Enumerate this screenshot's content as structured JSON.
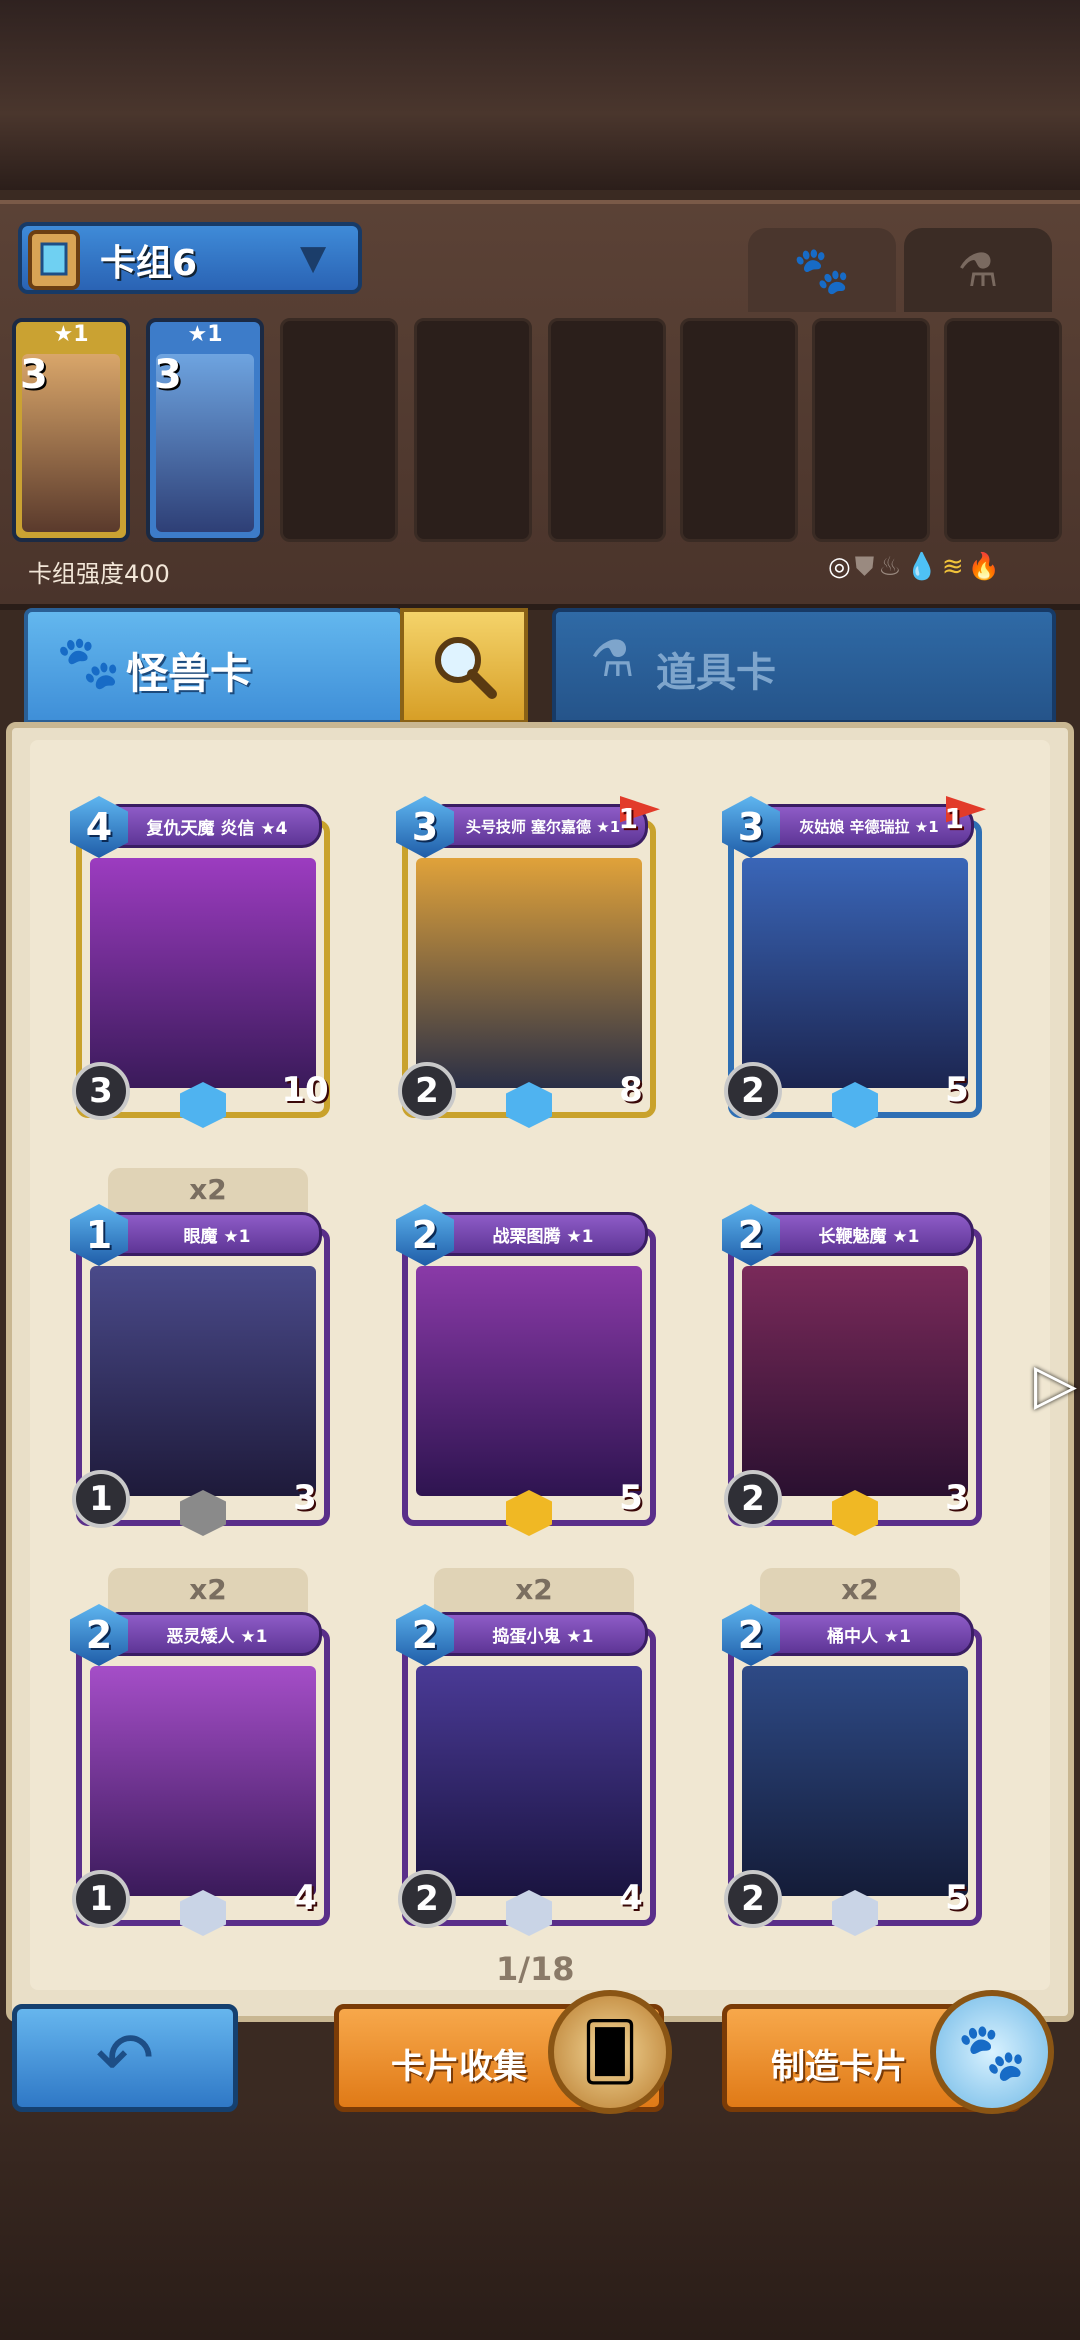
{
  "deck": {
    "name": "卡组6",
    "power_label": "卡组强度400",
    "filter_icons": [
      "circle-icon",
      "shield-icon",
      "flame-icon",
      "water-drop-icon",
      "wind-icon",
      "fire-icon"
    ],
    "slots": [
      {
        "stars": "★1",
        "cost": "3"
      },
      {
        "stars": "★1",
        "cost": "3"
      }
    ]
  },
  "tabs": {
    "monster": "怪兽卡",
    "item": "道具卡"
  },
  "cards": [
    {
      "name": "复仇天魔 炎信 ★4",
      "cost": "4",
      "attack": "3",
      "hp": "10"
    },
    {
      "name": "头号技师 塞尔嘉德 ★1",
      "cost": "3",
      "attack": "2",
      "hp": "8",
      "flag": "1"
    },
    {
      "name": "灰姑娘 辛德瑞拉 ★1",
      "cost": "3",
      "attack": "2",
      "hp": "5",
      "flag": "1"
    },
    {
      "name": "眼魔 ★1",
      "cost": "1",
      "attack": "1",
      "hp": "3",
      "count": "x2"
    },
    {
      "name": "战栗图腾 ★1",
      "cost": "2",
      "attack": "",
      "hp": "5"
    },
    {
      "name": "长鞭魅魔 ★1",
      "cost": "2",
      "attack": "2",
      "hp": "3"
    },
    {
      "name": "恶灵矮人 ★1",
      "cost": "2",
      "attack": "1",
      "hp": "4",
      "count": "x2"
    },
    {
      "name": "捣蛋小鬼 ★1",
      "cost": "2",
      "attack": "2",
      "hp": "4",
      "count": "x2"
    },
    {
      "name": "桶中人 ★1",
      "cost": "2",
      "attack": "2",
      "hp": "5",
      "count": "x2"
    }
  ],
  "pager": "1/18",
  "buttons": {
    "collect": "卡片收集",
    "craft": "制造卡片"
  },
  "colors": {
    "accent_blue": "#3f8fd8",
    "accent_orange": "#e07a17",
    "panel": "#f0e7d2"
  }
}
